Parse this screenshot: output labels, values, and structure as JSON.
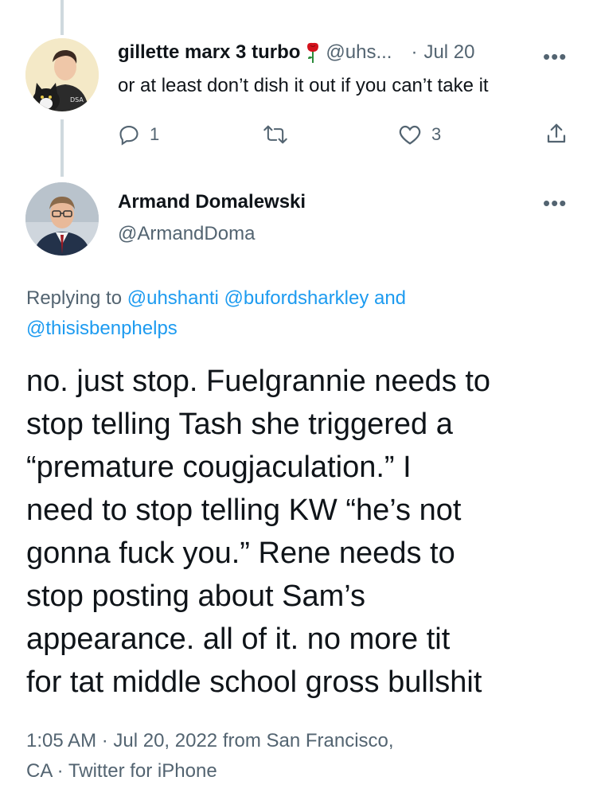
{
  "reply_tweet": {
    "display_name": "gillette marx 3 turbo",
    "handle": "@uhs...",
    "separator": "·",
    "date": "Jul 20",
    "avatar_shirt_text": "DSA",
    "text": "or at least don’t dish it out if you can’t take it",
    "replies": "1",
    "likes": "3",
    "icons": [
      "reply-icon",
      "retweet-icon",
      "like-icon",
      "share-icon",
      "rose-icon",
      "more-icon"
    ]
  },
  "main_tweet": {
    "display_name": "Armand Domalewski",
    "handle": "@ArmandDoma",
    "replying_prefix": "Replying to",
    "replying_users": [
      "@uhshanti",
      "@bufordsharkley",
      "@thisisbenphelps"
    ],
    "replying_and": "and",
    "text_lines": [
      "no. just stop. Fuelgrannie needs to",
      "stop telling Tash she triggered a",
      "“premature cougjaculation.” I",
      "need to stop telling KW “he’s not",
      "gonna fuck you.” Rene needs to",
      "stop posting about Sam’s",
      "appearance. all of it. no more tit",
      "for tat middle school gross bullshit"
    ],
    "meta_line_1": "1:05 AM · Jul 20, 2022 from San Francisco,",
    "meta_line_2": "CA · Twitter for iPhone"
  },
  "colors": {
    "link": "#1d9bf0",
    "muted": "#536471",
    "text": "#0f1419",
    "thread": "#cfd9de"
  }
}
